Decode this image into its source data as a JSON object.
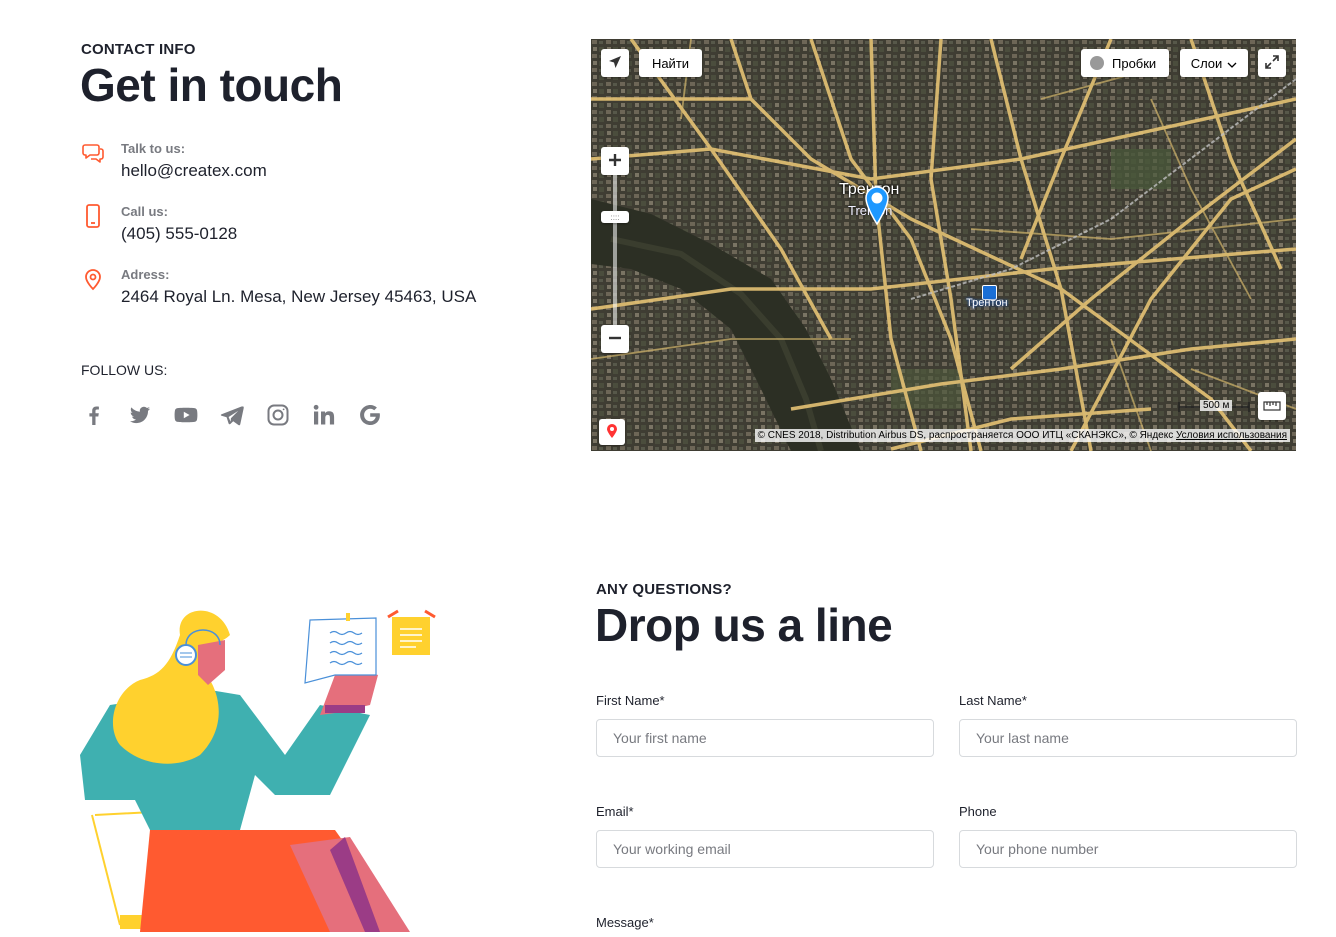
{
  "contact": {
    "eyebrow": "CONTACT INFO",
    "title": "Get in touch",
    "items": [
      {
        "icon": "chat-icon",
        "label": "Talk to us:",
        "value": "hello@createx.com"
      },
      {
        "icon": "phone-icon",
        "label": "Call us:",
        "value": "(405) 555-0128"
      },
      {
        "icon": "location-icon",
        "label": "Adress:",
        "value": "2464 Royal Ln. Mesa, New Jersey 45463, USA"
      }
    ],
    "follow_label": "FOLLOW US:",
    "socials": [
      "facebook-icon",
      "twitter-icon",
      "youtube-icon",
      "telegram-icon",
      "instagram-icon",
      "linkedin-icon",
      "google-icon"
    ]
  },
  "map": {
    "find_button": "Найти",
    "traffic_button": "Пробки",
    "layers_button": "Слои",
    "city_label_ru": "Трентон",
    "city_label_en": "Trenton",
    "station_label": "Трентон",
    "scale": "500 м",
    "attribution": "© CNES 2018, Distribution Airbus DS, распространяется ООО ИТЦ «СКАНЭКС», © Яндекс",
    "terms_link": "Условия использования"
  },
  "form": {
    "eyebrow": "ANY QUESTIONS?",
    "title": "Drop us a line",
    "first_name_label": "First Name*",
    "first_name_placeholder": "Your first name",
    "last_name_label": "Last Name*",
    "last_name_placeholder": "Your last name",
    "email_label": "Email*",
    "email_placeholder": "Your working email",
    "phone_label": "Phone",
    "phone_placeholder": "Your phone number",
    "message_label": "Message*"
  },
  "colors": {
    "accent": "#ff5a30",
    "text_dark": "#1e212c",
    "text_muted": "#787a80",
    "input_border": "#d7dadd"
  }
}
